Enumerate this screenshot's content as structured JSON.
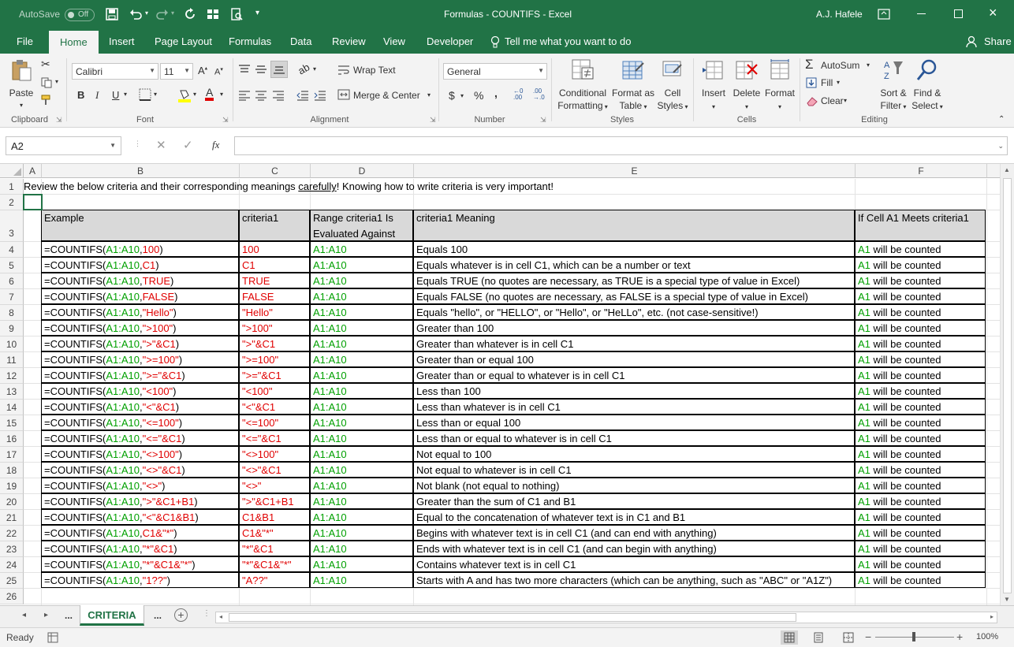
{
  "titlebar": {
    "autosave_label": "AutoSave",
    "autosave_state": "Off",
    "title": "Formulas - COUNTIFS  -  Excel",
    "user": "A.J. Hafele"
  },
  "tabs": [
    "File",
    "Home",
    "Insert",
    "Page Layout",
    "Formulas",
    "Data",
    "Review",
    "View",
    "Developer"
  ],
  "active_tab": "Home",
  "tell_me": "Tell me what you want to do",
  "share": "Share",
  "ribbon": {
    "clipboard": {
      "paste": "Paste",
      "group": "Clipboard"
    },
    "font": {
      "name": "Calibri",
      "size": "11",
      "group": "Font",
      "bold": "B",
      "italic": "I",
      "underline": "U"
    },
    "alignment": {
      "wrap": "Wrap Text",
      "merge": "Merge & Center",
      "group": "Alignment"
    },
    "number": {
      "format": "General",
      "group": "Number",
      "currency": "$",
      "percent": "%",
      "comma": ","
    },
    "styles": {
      "conditional": "Conditional",
      "conditional2": "Formatting",
      "format_as": "Format as",
      "format_as2": "Table",
      "cell": "Cell",
      "cell2": "Styles",
      "group": "Styles"
    },
    "cells": {
      "insert": "Insert",
      "delete": "Delete",
      "format": "Format",
      "group": "Cells"
    },
    "editing": {
      "autosum": "AutoSum",
      "fill": "Fill",
      "clear": "Clear",
      "sort": "Sort &",
      "sort2": "Filter",
      "find": "Find &",
      "find2": "Select",
      "group": "Editing"
    }
  },
  "formula_bar": {
    "name_box": "A2",
    "fx": "fx",
    "formula": ""
  },
  "columns": [
    "A",
    "B",
    "C",
    "D",
    "E",
    "F"
  ],
  "row_numbers": [
    "1",
    "2",
    "3",
    "4",
    "5",
    "6",
    "7",
    "8",
    "9",
    "10",
    "11",
    "12",
    "13",
    "14",
    "15",
    "16",
    "17",
    "18",
    "19",
    "20",
    "21",
    "22",
    "23",
    "24",
    "25",
    "26"
  ],
  "row1_text_before": "Review the below criteria and their corresponding meanings ",
  "row1_text_underlined": "carefully",
  "row1_text_after": "!  Knowing how to write criteria is very important!",
  "table_headers": {
    "example": "Example",
    "criteria1": "criteria1",
    "range_line1": "Range criteria1 Is",
    "range_line2": "Evaluated Against",
    "meaning": "criteria1 Meaning",
    "if_meets": "If Cell A1 Meets criteria1"
  },
  "rows": [
    {
      "ex_pre": "=COUNTIFS(",
      "ex_range": "A1:A10",
      "ex_sep": ",",
      "ex_crit": "100",
      "ex_post": ")",
      "crit": "100",
      "range": "A1:A10",
      "meaning": "Equals 100",
      "a1": "A1",
      "result": " will be counted"
    },
    {
      "ex_pre": "=COUNTIFS(",
      "ex_range": "A1:A10",
      "ex_sep": ",",
      "ex_crit": "C1",
      "ex_post": ")",
      "crit": "C1",
      "range": "A1:A10",
      "meaning": "Equals whatever is in cell C1, which can be a number or text",
      "a1": "A1",
      "result": " will be counted"
    },
    {
      "ex_pre": "=COUNTIFS(",
      "ex_range": "A1:A10",
      "ex_sep": ",",
      "ex_crit": "TRUE",
      "ex_post": ")",
      "crit": "TRUE",
      "range": "A1:A10",
      "meaning": "Equals TRUE (no quotes are necessary, as TRUE is a special type of value in Excel)",
      "a1": "A1",
      "result": " will be counted"
    },
    {
      "ex_pre": "=COUNTIFS(",
      "ex_range": "A1:A10",
      "ex_sep": ",",
      "ex_crit": "FALSE",
      "ex_post": ")",
      "crit": "FALSE",
      "range": "A1:A10",
      "meaning": "Equals FALSE (no quotes are necessary, as FALSE is a special type of value in Excel)",
      "a1": "A1",
      "result": " will be counted"
    },
    {
      "ex_pre": "=COUNTIFS(",
      "ex_range": "A1:A10",
      "ex_sep": ",",
      "ex_crit": "\"Hello\"",
      "ex_post": ")",
      "crit": "\"Hello\"",
      "range": "A1:A10",
      "meaning": "Equals \"hello\", or \"HELLO\", or \"Hello\", or \"HeLLo\", etc. (not case-sensitive!)",
      "a1": "A1",
      "result": " will be counted"
    },
    {
      "ex_pre": "=COUNTIFS(",
      "ex_range": "A1:A10",
      "ex_sep": ",",
      "ex_crit": "\">100\"",
      "ex_post": ")",
      "crit": "\">100\"",
      "range": "A1:A10",
      "meaning": "Greater than 100",
      "a1": "A1",
      "result": " will be counted"
    },
    {
      "ex_pre": "=COUNTIFS(",
      "ex_range": "A1:A10",
      "ex_sep": ",",
      "ex_crit": "\">\"&C1",
      "ex_post": ")",
      "crit": "\">\"&C1",
      "range": "A1:A10",
      "meaning": "Greater than whatever is in cell C1",
      "a1": "A1",
      "result": " will be counted"
    },
    {
      "ex_pre": "=COUNTIFS(",
      "ex_range": "A1:A10",
      "ex_sep": ",",
      "ex_crit": "\">=100\"",
      "ex_post": ")",
      "crit": "\">=100\"",
      "range": "A1:A10",
      "meaning": "Greater than or equal 100",
      "a1": "A1",
      "result": " will be counted"
    },
    {
      "ex_pre": "=COUNTIFS(",
      "ex_range": "A1:A10",
      "ex_sep": ",",
      "ex_crit": "\">=\"&C1",
      "ex_post": ")",
      "crit": "\">=\"&C1",
      "range": "A1:A10",
      "meaning": "Greater than or equal to whatever is in cell C1",
      "a1": "A1",
      "result": " will be counted"
    },
    {
      "ex_pre": "=COUNTIFS(",
      "ex_range": "A1:A10",
      "ex_sep": ",",
      "ex_crit": "\"<100\"",
      "ex_post": ")",
      "crit": "\"<100\"",
      "range": "A1:A10",
      "meaning": "Less than 100",
      "a1": "A1",
      "result": " will be counted"
    },
    {
      "ex_pre": "=COUNTIFS(",
      "ex_range": "A1:A10",
      "ex_sep": ",",
      "ex_crit": "\"<\"&C1",
      "ex_post": ")",
      "crit": "\"<\"&C1",
      "range": "A1:A10",
      "meaning": "Less than whatever is in cell C1",
      "a1": "A1",
      "result": " will be counted"
    },
    {
      "ex_pre": "=COUNTIFS(",
      "ex_range": "A1:A10",
      "ex_sep": ",",
      "ex_crit": "\"<=100\"",
      "ex_post": ")",
      "crit": "\"<=100\"",
      "range": "A1:A10",
      "meaning": "Less than or equal 100",
      "a1": "A1",
      "result": " will be counted"
    },
    {
      "ex_pre": "=COUNTIFS(",
      "ex_range": "A1:A10",
      "ex_sep": ",",
      "ex_crit": "\"<=\"&C1",
      "ex_post": ")",
      "crit": "\"<=\"&C1",
      "range": "A1:A10",
      "meaning": "Less than or equal to whatever is in cell C1",
      "a1": "A1",
      "result": " will be counted"
    },
    {
      "ex_pre": "=COUNTIFS(",
      "ex_range": "A1:A10",
      "ex_sep": ",",
      "ex_crit": "\"<>100\"",
      "ex_post": ")",
      "crit": "\"<>100\"",
      "range": "A1:A10",
      "meaning": "Not equal to 100",
      "a1": "A1",
      "result": " will be counted"
    },
    {
      "ex_pre": "=COUNTIFS(",
      "ex_range": "A1:A10",
      "ex_sep": ",",
      "ex_crit": "\"<>\"&C1",
      "ex_post": ")",
      "crit": "\"<>\"&C1",
      "range": "A1:A10",
      "meaning": "Not equal to whatever is in cell C1",
      "a1": "A1",
      "result": " will be counted"
    },
    {
      "ex_pre": "=COUNTIFS(",
      "ex_range": "A1:A10",
      "ex_sep": ",",
      "ex_crit": "\"<>\"",
      "ex_post": ")",
      "crit": "\"<>\"",
      "range": "A1:A10",
      "meaning": "Not blank (not equal to nothing)",
      "a1": "A1",
      "result": " will be counted"
    },
    {
      "ex_pre": "=COUNTIFS(",
      "ex_range": "A1:A10",
      "ex_sep": ",",
      "ex_crit": "\">\"&C1+B1",
      "ex_post": ")",
      "crit": "\">\"&C1+B1",
      "range": "A1:A10",
      "meaning": "Greater than the sum of C1 and B1",
      "a1": "A1",
      "result": " will be counted"
    },
    {
      "ex_pre": "=COUNTIFS(",
      "ex_range": "A1:A10",
      "ex_sep": ",",
      "ex_crit": "\"<\"&C1&B1",
      "ex_post": ")",
      "crit": "C1&B1",
      "range": "A1:A10",
      "meaning": "Equal to the concatenation of whatever text is in C1 and B1",
      "a1": "A1",
      "result": " will be counted"
    },
    {
      "ex_pre": "=COUNTIFS(",
      "ex_range": "A1:A10",
      "ex_sep": ",",
      "ex_crit": "C1&\"*\"",
      "ex_post": ")",
      "crit": "C1&\"*\"",
      "range": "A1:A10",
      "meaning": "Begins with whatever text is in cell C1 (and can end with anything)",
      "a1": "A1",
      "result": " will be counted"
    },
    {
      "ex_pre": "=COUNTIFS(",
      "ex_range": "A1:A10",
      "ex_sep": ",",
      "ex_crit": "\"*\"&C1",
      "ex_post": ")",
      "crit": "\"*\"&C1",
      "range": "A1:A10",
      "meaning": "Ends with whatever text is in cell C1 (and can begin with anything)",
      "a1": "A1",
      "result": " will be counted"
    },
    {
      "ex_pre": "=COUNTIFS(",
      "ex_range": "A1:A10",
      "ex_sep": ",",
      "ex_crit": "\"*\"&C1&\"*\"",
      "ex_post": ")",
      "crit": "\"*\"&C1&\"*\"",
      "range": "A1:A10",
      "meaning": "Contains whatever text is in cell C1",
      "a1": "A1",
      "result": " will be counted"
    },
    {
      "ex_pre": "=COUNTIFS(",
      "ex_range": "A1:A10",
      "ex_sep": ",",
      "ex_crit": "\"1??\"",
      "ex_post": ")",
      "crit": "\"A??\"",
      "range": "A1:A10",
      "meaning": "Starts with A and has two more characters (which can be anything, such as \"ABC\" or \"A1Z\")",
      "a1": "A1",
      "result": " will be counted"
    }
  ],
  "sheet_tabs": {
    "prev_more": "...",
    "active": "CRITERIA",
    "next_more": "..."
  },
  "status": {
    "ready": "Ready",
    "zoom": "100%"
  },
  "colors": {
    "accent": "#217346",
    "range_green": "#00a000",
    "crit_red": "#e00000"
  }
}
